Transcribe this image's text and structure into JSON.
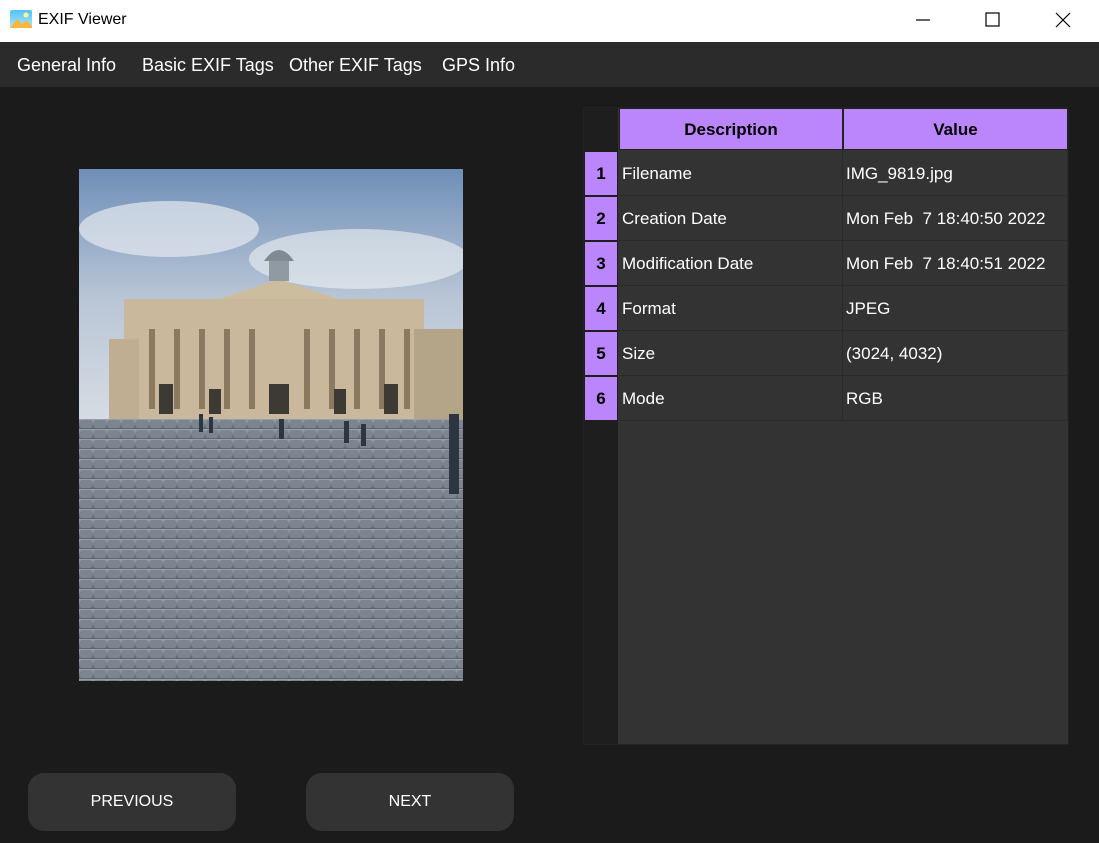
{
  "window": {
    "title": "EXIF Viewer"
  },
  "menu": [
    "General Info",
    "Basic EXIF Tags",
    "Other EXIF Tags",
    "GPS Info"
  ],
  "buttons": {
    "previous": "PREVIOUS",
    "next": "NEXT"
  },
  "table": {
    "headers": [
      "Description",
      "Value"
    ],
    "rows": [
      {
        "num": "1",
        "description": "Filename",
        "value": "IMG_9819.jpg"
      },
      {
        "num": "2",
        "description": "Creation Date",
        "value": "Mon Feb  7 18:40:50 2022"
      },
      {
        "num": "3",
        "description": "Modification Date",
        "value": "Mon Feb  7 18:40:51 2022"
      },
      {
        "num": "4",
        "description": "Format",
        "value": "JPEG"
      },
      {
        "num": "5",
        "description": "Size",
        "value": "(3024, 4032)"
      },
      {
        "num": "6",
        "description": "Mode",
        "value": "RGB"
      }
    ]
  },
  "colors": {
    "accent": "#bb86fc",
    "background": "#1b1b1b",
    "panel": "#333333",
    "menubar": "#2b2b2b"
  },
  "icons": [
    "app-image-icon",
    "minimize-icon",
    "maximize-icon",
    "close-icon"
  ]
}
